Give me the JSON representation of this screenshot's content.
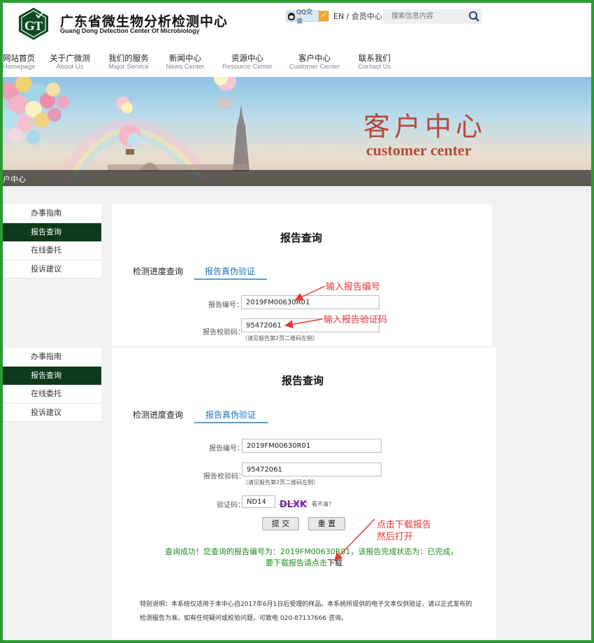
{
  "header": {
    "logo_cn": "广东省微生物分析检测中心",
    "logo_en": "Guang Dong Detection Center Of Microbiology",
    "qq_label": "QQ交谈",
    "lang_en": "EN",
    "lang_sep": " / ",
    "member": "会员中心",
    "search_placeholder": "搜索信息内容"
  },
  "nav": [
    {
      "cn": "网站首页",
      "en": "Homepage"
    },
    {
      "cn": "关于广微测",
      "en": "About Us"
    },
    {
      "cn": "我们的服务",
      "en": "Major Service"
    },
    {
      "cn": "新闻中心",
      "en": "News Center"
    },
    {
      "cn": "资源中心",
      "en": "Resource Center"
    },
    {
      "cn": "客户中心",
      "en": "Customer Center"
    },
    {
      "cn": "联系我们",
      "en": "Contact Us"
    }
  ],
  "banner": {
    "title_cn": "客户中心",
    "title_en": "customer center",
    "crumb": "户中心"
  },
  "sidebar": {
    "items": [
      "办事指南",
      "报告查询",
      "在线委托",
      "投诉建议"
    ],
    "active_index": 1
  },
  "form": {
    "title": "报告查询",
    "tab_progress": "检测进度查询",
    "tab_verify": "报告真伪验证",
    "report_no_label": "报告编号：",
    "report_no_value": "2019FM00630R01",
    "check_code_label": "报告校验码：",
    "check_code_value": "95472061",
    "check_code_hint": "（请见报告第2页二维码左侧）",
    "captcha_label": "验证码：",
    "captcha_value": "ND14",
    "captcha_text": "DLXK",
    "cant_see": "看不清?",
    "submit_label": "提 交",
    "reset_label": "重 置",
    "success_line1": "查询成功！您查询的报告编号为：2019FM00630R01，该报告完成状态为：已完成，",
    "success_line2_prefix": "要下载报告请点击",
    "download_label": "下载",
    "note": "特别说明：本系统仅适用于本中心自2017年6月1日后受理的样品。本系统所提供的电子文本仅供验证，请以正式发布的检测报告为准。如有任何疑问或校验问题，可致电 020-87137666 咨询。"
  },
  "annotations": {
    "enter_report_no": "输入报告编号",
    "enter_check_code": "输入报告验证码",
    "click_download_1": "点击下载报告",
    "click_download_2": "然后打开"
  },
  "colors": {
    "frame_green": "#2a9a34",
    "active_nav": "#0c3a1a",
    "tab_blue": "#1a73c2",
    "success_green": "#1e8c1e",
    "annotation_red": "#e53935",
    "banner_title": "#b4493c"
  }
}
